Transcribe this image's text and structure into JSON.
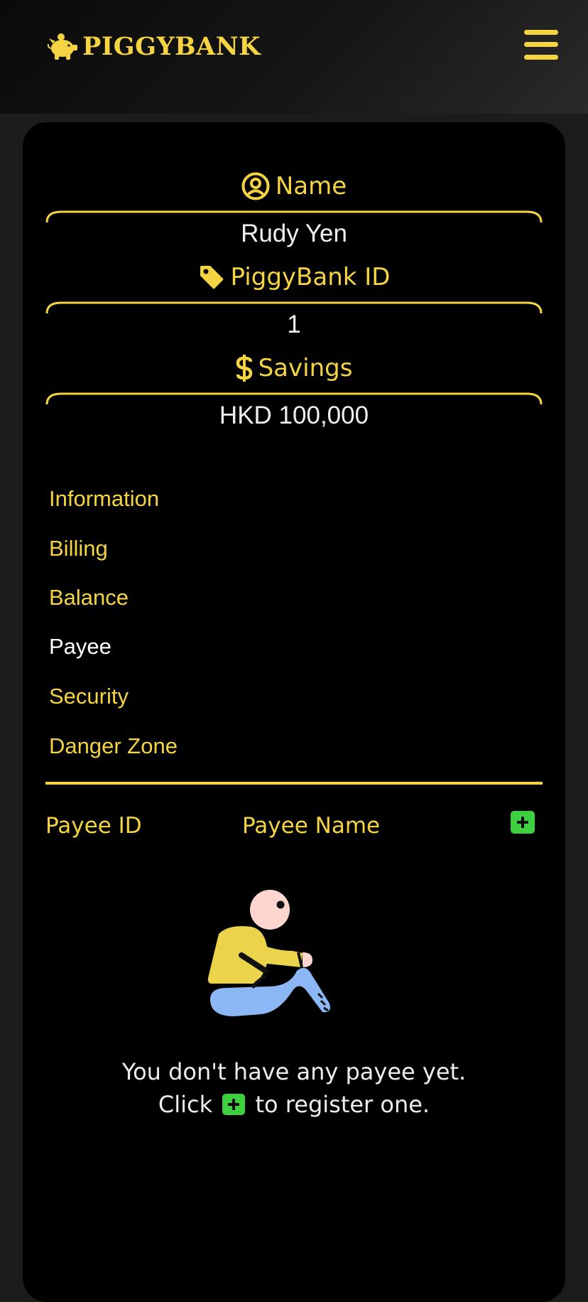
{
  "header": {
    "brand": "PIGGYBANK",
    "brand_icon": "piggy-bank-icon",
    "menu_icon": "hamburger-menu-icon"
  },
  "profile": {
    "name_label": "Name",
    "name_value": "Rudy Yen",
    "id_label": "PiggyBank ID",
    "id_value": "1",
    "savings_label": "Savings",
    "savings_value": "HKD 100,000"
  },
  "tabs": [
    {
      "label": "Information",
      "active": false
    },
    {
      "label": "Billing",
      "active": false
    },
    {
      "label": "Balance",
      "active": false
    },
    {
      "label": "Payee",
      "active": true
    },
    {
      "label": "Security",
      "active": false
    },
    {
      "label": "Danger Zone",
      "active": false
    }
  ],
  "payee_table": {
    "col_id": "Payee ID",
    "col_name": "Payee Name",
    "add_icon": "plus-icon"
  },
  "empty_state": {
    "line1": "You don't have any payee yet.",
    "line2_before": "Click",
    "line2_after": "to register one."
  },
  "colors": {
    "accent": "#f5d442",
    "add_button": "#3ecf3e",
    "card_background": "#000000",
    "page_background": "#1c1c1c"
  }
}
